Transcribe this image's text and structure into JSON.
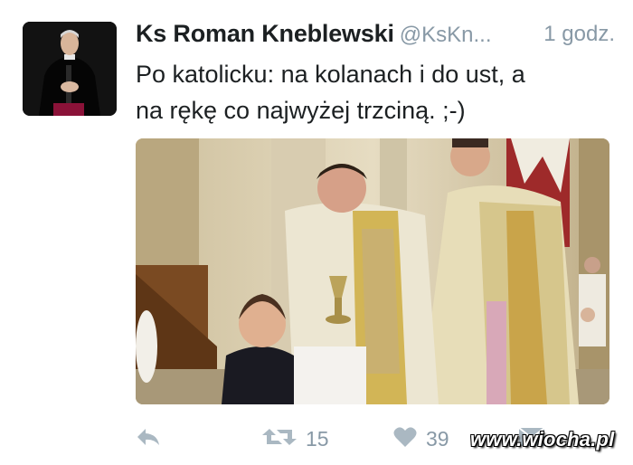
{
  "tweet": {
    "author_name": "Ks Roman Kneblewski",
    "handle": "@KsKn...",
    "time": "1 godz.",
    "text": "Po katolicku: na kolanach i do ust, a\nna rękę co najwyżej trzciną.  ;-)"
  },
  "actions": {
    "reply_icon": "reply-arrow-icon",
    "retweet_icon": "retweet-icon",
    "retweet_count": "15",
    "like_icon": "heart-icon",
    "like_count": "39",
    "dm_icon": "envelope-icon"
  },
  "watermark": "www.wiocha.pl",
  "colors": {
    "text_primary": "#1c2022",
    "text_secondary": "#8899a6",
    "icon_gray": "#aab8c2"
  }
}
